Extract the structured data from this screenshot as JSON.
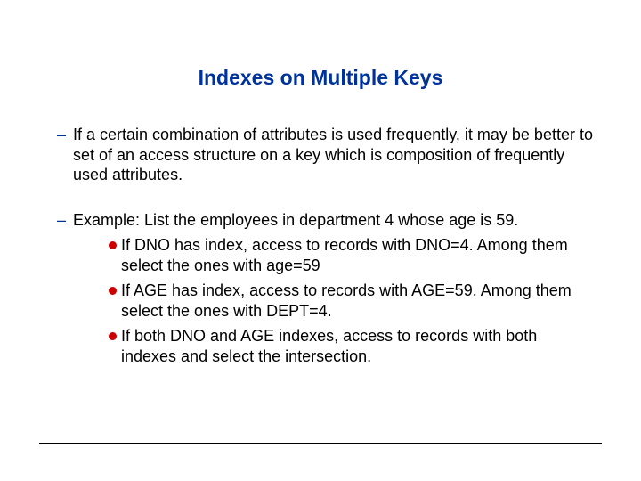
{
  "title": "Indexes on Multiple Keys",
  "bullets": [
    {
      "text": "If a certain combination of attributes is used frequently, it may be better to set of an access structure on a key which is composition of frequently used attributes."
    },
    {
      "text": "Example: List the employees in department 4 whose age is 59.",
      "sub": [
        "If DNO has index, access to records with DNO=4. Among them select the ones with age=59",
        "If AGE has index, access to records with AGE=59. Among them select the ones with DEPT=4.",
        "If both DNO and AGE indexes, access to records with both indexes and select the intersection."
      ]
    }
  ]
}
